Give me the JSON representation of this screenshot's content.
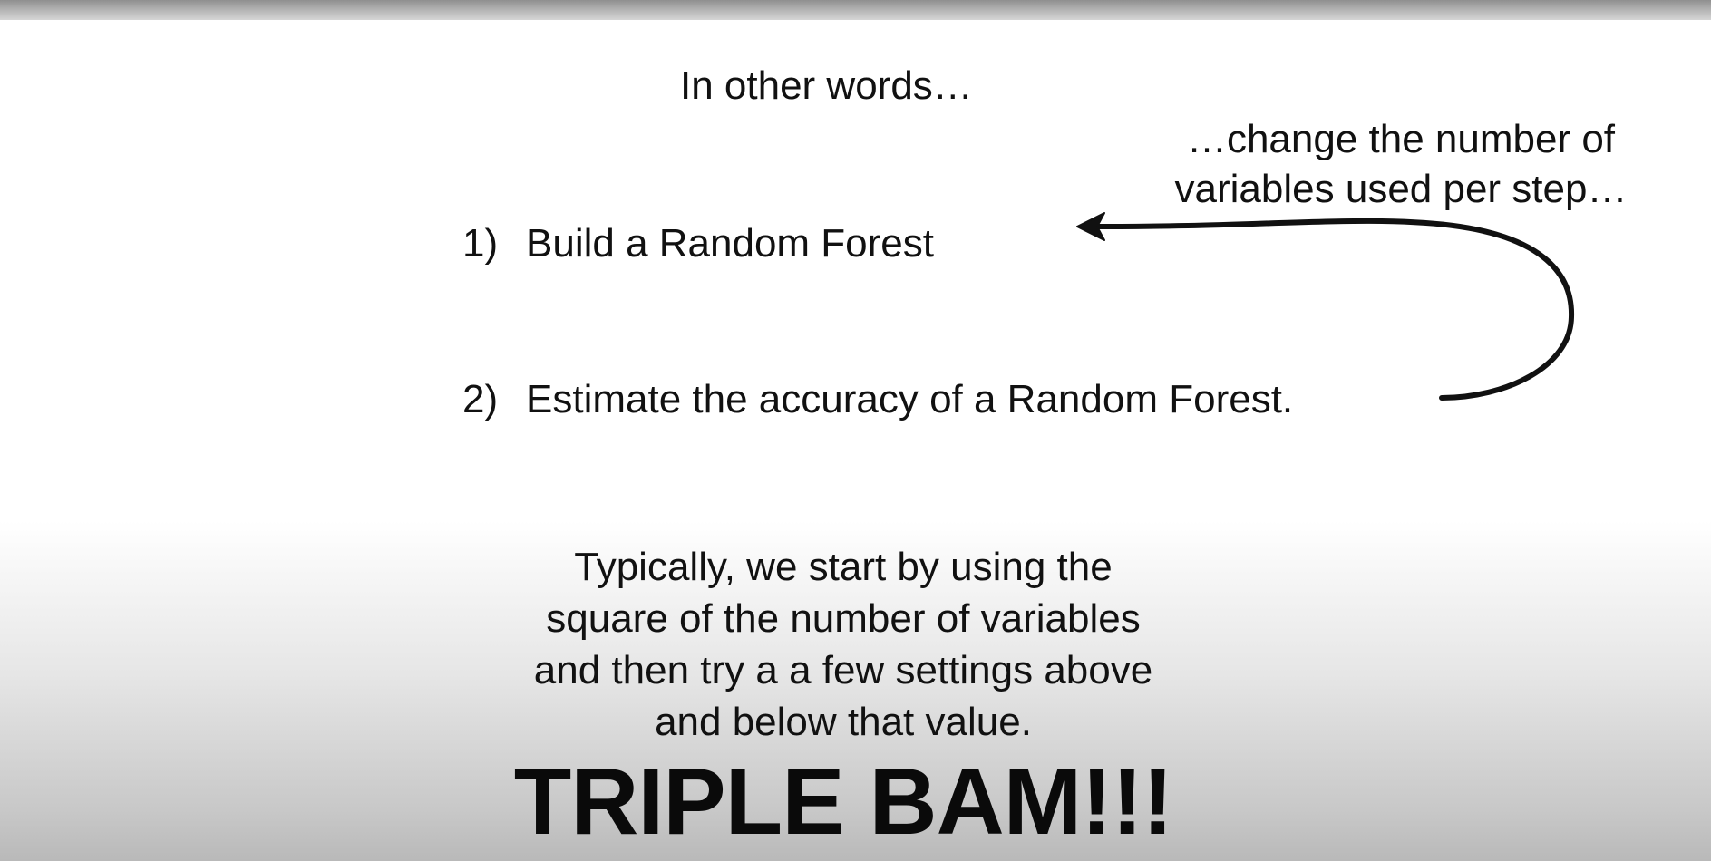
{
  "slide": {
    "heading": "In other words…",
    "steps": [
      {
        "number": "1)",
        "text": "Build a Random Forest"
      },
      {
        "number": "2)",
        "text": "Estimate the accuracy of a Random Forest."
      }
    ],
    "annotation": {
      "line1": "…change the number of",
      "line2": "variables used per step…"
    },
    "note_lines": [
      "Typically, we start by using the",
      "square of the number of variables",
      "and then try a a few settings above",
      "and below that value."
    ],
    "exclamation": "TRIPLE BAM!!!"
  },
  "icons": {
    "loop_arrow": "curved-arrow-icon"
  },
  "colors": {
    "text": "#111111",
    "background": "#ffffff"
  }
}
